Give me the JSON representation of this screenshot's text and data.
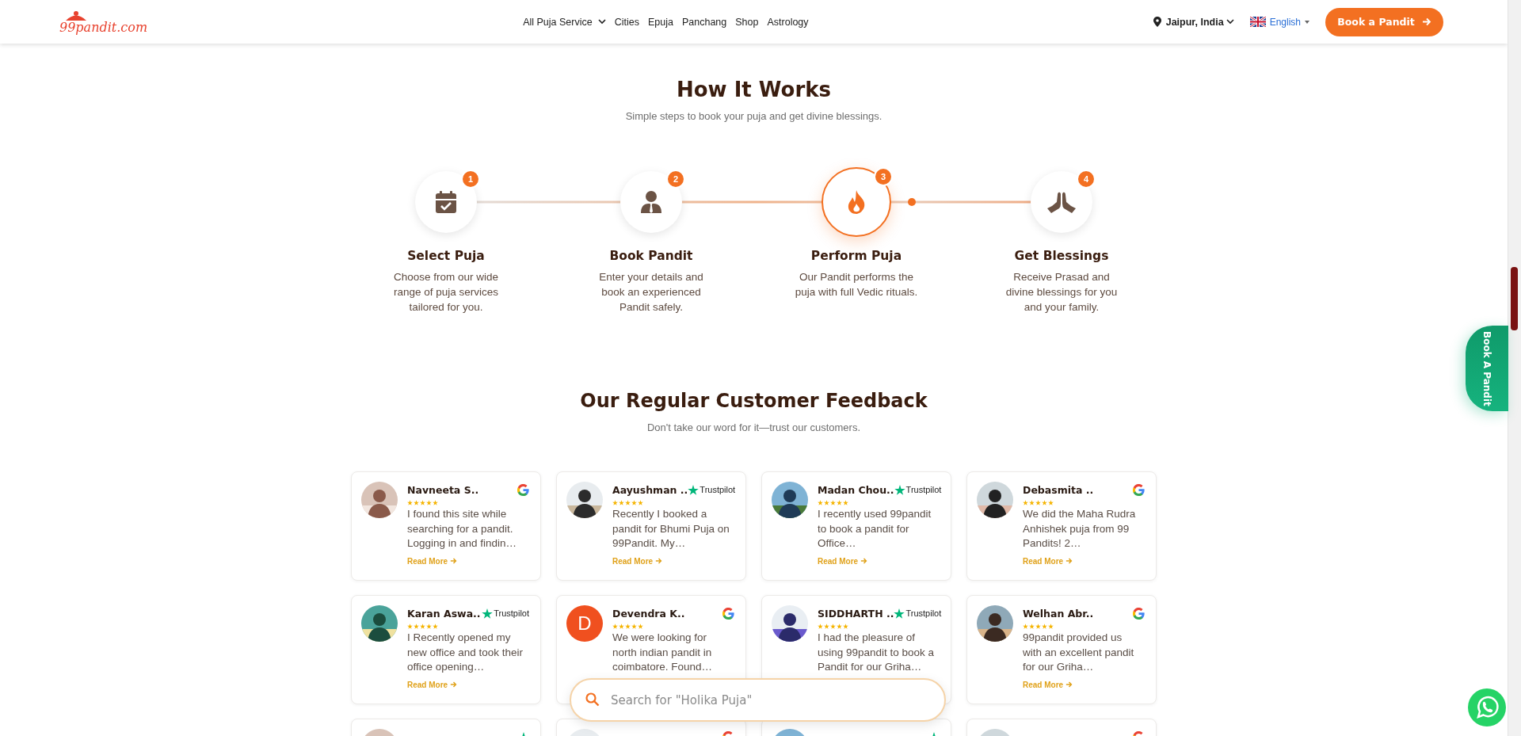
{
  "header": {
    "logo_text": "99pandit.com",
    "nav": [
      {
        "label": "All Puja Service",
        "has_caret": true
      },
      {
        "label": "Cities",
        "has_caret": false
      },
      {
        "label": "Epuja",
        "has_caret": false
      },
      {
        "label": "Panchang",
        "has_caret": false
      },
      {
        "label": "Shop",
        "has_caret": false
      },
      {
        "label": "Astrology",
        "has_caret": false
      }
    ],
    "location": "Jaipur, India",
    "language": "English",
    "cta": "Book a Pandit"
  },
  "how_it_works": {
    "title": "How It Works",
    "subtitle": "Simple steps to book your puja and get divine blessings.",
    "steps": [
      {
        "number": "1",
        "kind": "calendar",
        "title": "Select Puja",
        "text": "Choose from our wide range of puja services tailored for you.",
        "active": false
      },
      {
        "number": "2",
        "kind": "person",
        "title": "Book Pandit",
        "text": "Enter your details and book an experienced Pandit safely.",
        "active": false
      },
      {
        "number": "3",
        "kind": "flame",
        "title": "Perform Puja",
        "text": "Our Pandit performs the puja with full Vedic rituals.",
        "active": true
      },
      {
        "number": "4",
        "kind": "hands",
        "title": "Get Blessings",
        "text": "Receive Prasad and divine blessings for you and your family.",
        "active": false
      }
    ]
  },
  "feedback": {
    "title": "Our Regular Customer Feedback",
    "subtitle": "Don't take our word for it—trust our customers.",
    "reviews": [
      {
        "name": "Navneeta S..",
        "source": {
          "kind": "google"
        },
        "stars": 5,
        "text": "I found this site while searching for a pandit. Logging in and findin…",
        "read_more": "Read More"
      },
      {
        "name": "Aayushman ..",
        "source": {
          "kind": "trustpilot",
          "label": "Trustpilot"
        },
        "stars": 5,
        "text": "Recently I booked a pandit for Bhumi Puja on 99Pandit. My…",
        "read_more": "Read More"
      },
      {
        "name": "Madan Chou..",
        "source": {
          "kind": "trustpilot",
          "label": "Trustpilot"
        },
        "stars": 5,
        "text": "I recently used 99pandit to book a pandit for Office…",
        "read_more": "Read More"
      },
      {
        "name": "Debasmita ..",
        "source": {
          "kind": "google"
        },
        "stars": 5,
        "text": "We did the Maha Rudra Anhishek puja from 99 Pandits! 2…",
        "read_more": "Read More"
      },
      {
        "name": "Karan Aswa..",
        "source": {
          "kind": "trustpilot",
          "label": "Trustpilot"
        },
        "stars": 5,
        "text": "I Recently opened my new office and took their office opening…",
        "read_more": "Read More"
      },
      {
        "name": "Devendra K..",
        "avatar": {
          "kind": "letter",
          "initial": "D"
        },
        "source": {
          "kind": "google"
        },
        "stars": 5,
        "text": "We were looking for north indian pandit in coimbatore. Found…"
      },
      {
        "name": "SIDDHARTH ..",
        "source": {
          "kind": "trustpilot",
          "label": "Trustpilot"
        },
        "stars": 5,
        "text": "I had the pleasure of using 99pandit to book a Pandit for our Griha…"
      },
      {
        "name": "Welhan Abr..",
        "source": {
          "kind": "google"
        },
        "stars": 5,
        "text": "99pandit provided us with an excellent pandit for our Griha…",
        "read_more": "Read More"
      },
      {
        "source": {
          "kind": "trustpilot"
        }
      },
      {
        "source": {
          "kind": "google"
        }
      },
      {
        "source": {
          "kind": "trustpilot"
        }
      },
      {
        "source": {
          "kind": "google"
        }
      }
    ]
  },
  "search": {
    "placeholder": "Search for \"Holika Puja\""
  },
  "side_tab": "Book A Pandit"
}
